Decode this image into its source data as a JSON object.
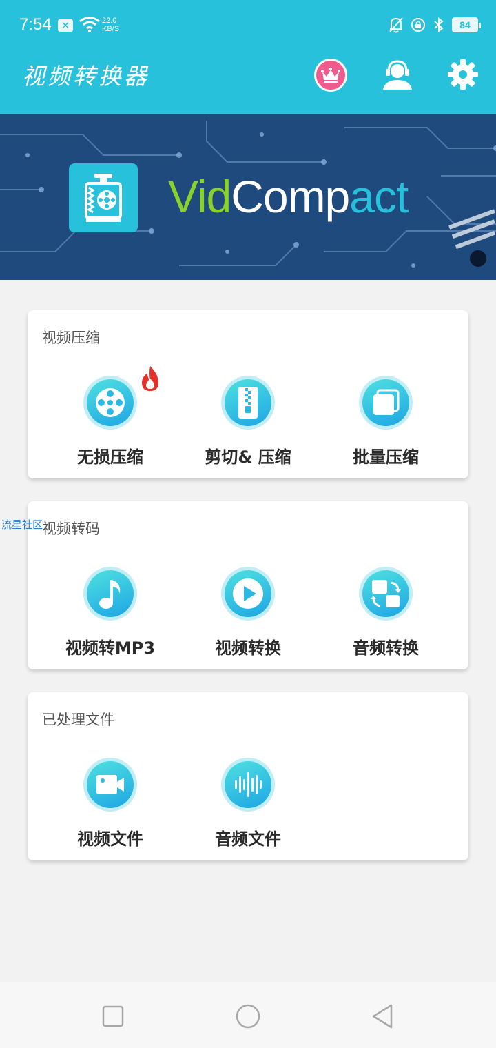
{
  "status_bar": {
    "time": "7:54",
    "notification_badge": "✕",
    "net_speed_value": "22.0",
    "net_speed_unit": "KB/S",
    "battery": "84"
  },
  "app_bar": {
    "title": "视频转换器",
    "icons": [
      "crown-icon",
      "customer-support-icon",
      "gear-icon"
    ]
  },
  "banner": {
    "brand_part1": "Vid",
    "brand_part2": "Comp",
    "brand_part3": "act",
    "colors": {
      "vid": "#8ad12c",
      "comp": "#ffffff",
      "act": "#27c1dc",
      "background": "#1f4a7e"
    }
  },
  "sections": {
    "compress": {
      "title": "视频压缩",
      "items": [
        {
          "label": "无损压缩",
          "icon": "film-reel-icon",
          "badge": "fire-icon"
        },
        {
          "label": "剪切& 压缩",
          "icon": "zip-icon"
        },
        {
          "label": "批量压缩",
          "icon": "stack-icon"
        }
      ]
    },
    "transcode": {
      "title": "视频转码",
      "items": [
        {
          "label": "视频转MP3",
          "icon": "music-note-icon"
        },
        {
          "label": "视频转换",
          "icon": "play-icon"
        },
        {
          "label": "音频转换",
          "icon": "convert-icon"
        }
      ]
    },
    "processed": {
      "title": "已处理文件",
      "items": [
        {
          "label": "视频文件",
          "icon": "video-camera-icon"
        },
        {
          "label": "音频文件",
          "icon": "audio-wave-icon"
        }
      ]
    }
  },
  "watermark": "流星社区",
  "colors": {
    "primary": "#27c1dc",
    "crown": "#f05a8c",
    "fire": "#e8302a"
  }
}
